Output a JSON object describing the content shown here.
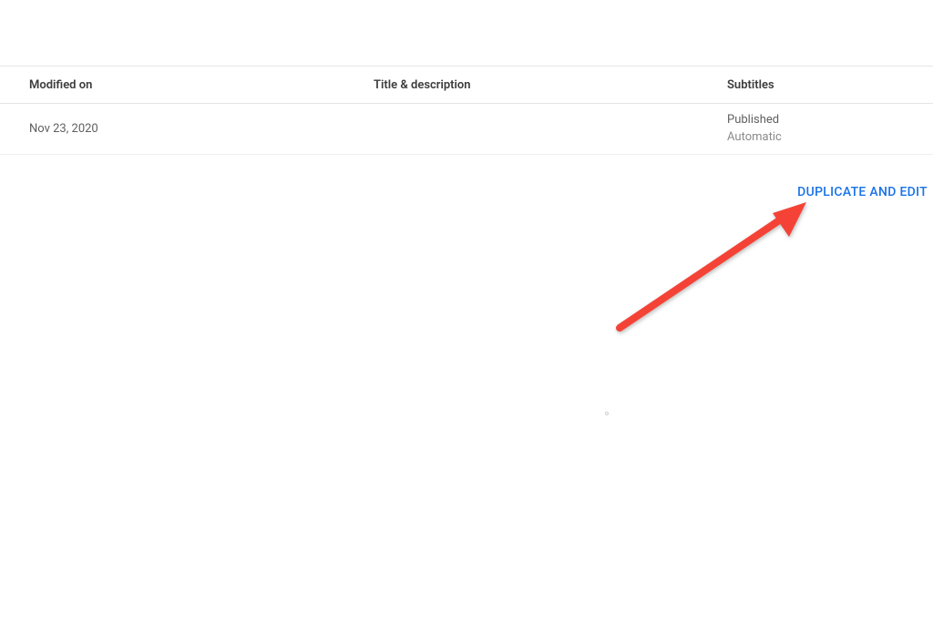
{
  "headers": {
    "modified": "Modified on",
    "title": "Title & description",
    "subtitles": "Subtitles"
  },
  "row": {
    "modified_on": "Nov 23, 2020",
    "title_description": "",
    "subtitles_status": "Published",
    "subtitles_source": "Automatic"
  },
  "actions": {
    "duplicate_edit": "Duplicate and Edit"
  },
  "annotation": {
    "arrow_color": "#f44336"
  }
}
